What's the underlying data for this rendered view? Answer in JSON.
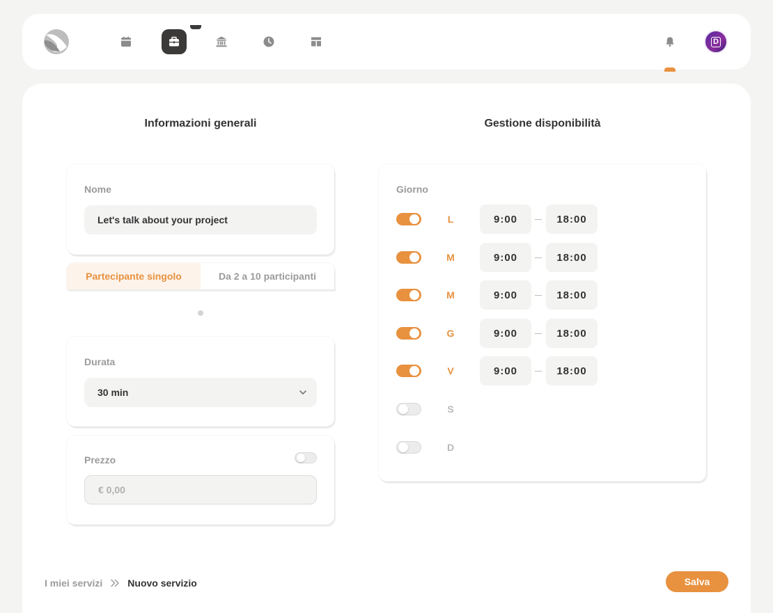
{
  "colors": {
    "accent": "#e8913f",
    "dark": "#3b3a39",
    "background": "#f4f4f2"
  },
  "nav": {
    "items": [
      {
        "icon": "calendar-icon"
      },
      {
        "icon": "briefcase-icon",
        "active": true
      },
      {
        "icon": "bank-icon"
      },
      {
        "icon": "clock-icon"
      },
      {
        "icon": "layout-icon"
      }
    ],
    "notifications_icon": "bell-icon",
    "avatar_letter": "D"
  },
  "general": {
    "title": "Informazioni generali",
    "name_label": "Nome",
    "name_value": "Let's talk about your project",
    "participants": {
      "single": "Partecipante singolo",
      "group": "Da 2 a 10 participanti",
      "selected": "single"
    },
    "duration_label": "Durata",
    "duration_value": "30 min",
    "price_label": "Prezzo",
    "price_enabled": false,
    "price_placeholder": "€ 0,00"
  },
  "availability": {
    "title": "Gestione disponibilità",
    "day_header": "Giorno",
    "days": [
      {
        "letter": "L",
        "enabled": true,
        "start": "9:00",
        "end": "18:00"
      },
      {
        "letter": "M",
        "enabled": true,
        "start": "9:00",
        "end": "18:00"
      },
      {
        "letter": "M",
        "enabled": true,
        "start": "9:00",
        "end": "18:00"
      },
      {
        "letter": "G",
        "enabled": true,
        "start": "9:00",
        "end": "18:00"
      },
      {
        "letter": "V",
        "enabled": true,
        "start": "9:00",
        "end": "18:00"
      },
      {
        "letter": "S",
        "enabled": false
      },
      {
        "letter": "D",
        "enabled": false
      }
    ]
  },
  "breadcrumb": {
    "parent": "I miei servizi",
    "current": "Nuovo servizio"
  },
  "save_label": "Salva"
}
